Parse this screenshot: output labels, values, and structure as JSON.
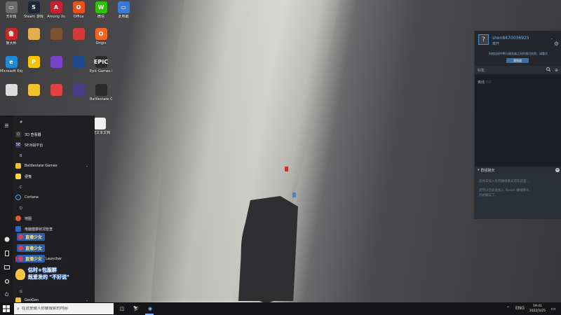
{
  "desktop": {
    "icons": [
      {
        "label": "无标题",
        "glyph": "▭",
        "color": "#6a6a6a"
      },
      {
        "label": "Steam 游戏",
        "glyph": "S",
        "color": "#1b2838"
      },
      {
        "label": "Among Us",
        "glyph": "A",
        "color": "#c8202c"
      },
      {
        "label": "Office",
        "glyph": "O",
        "color": "#e8501e"
      },
      {
        "label": "微信",
        "glyph": "W",
        "color": "#2dc100"
      },
      {
        "label": "此电脑",
        "glyph": "▭",
        "color": "#3b7ad0"
      },
      {
        "label": "鲁大师",
        "glyph": "鲁",
        "color": "#c62828"
      },
      {
        "label": "",
        "glyph": "",
        "color": "#e0b050"
      },
      {
        "label": "",
        "glyph": "",
        "color": "#7a5230"
      },
      {
        "label": "",
        "glyph": "",
        "color": "#d33a3a"
      },
      {
        "label": "Origin",
        "glyph": "O",
        "color": "#f26522"
      },
      {
        "label": "Microsoft Edge",
        "glyph": "e",
        "color": "#1f8ad8"
      },
      {
        "label": "",
        "glyph": "P",
        "color": "#f6c500"
      },
      {
        "label": "",
        "glyph": "",
        "color": "#7a42c8"
      },
      {
        "label": "",
        "glyph": "",
        "color": "#1a4a8a"
      },
      {
        "label": "Epic Games Launcher",
        "glyph": "EPIC",
        "color": "#2a2a2a"
      },
      {
        "label": "",
        "glyph": "",
        "color": "#dddddd"
      },
      {
        "label": "",
        "glyph": "",
        "color": "#f2c12e"
      },
      {
        "label": "",
        "glyph": "",
        "color": "#e04040"
      },
      {
        "label": "",
        "glyph": "",
        "color": "#4a3a8a"
      },
      {
        "label": "Battlestate Games",
        "glyph": "",
        "color": "#2a2a2a"
      },
      {
        "label": "新建文本文档",
        "glyph": "",
        "color": "#f0f0f0"
      }
    ]
  },
  "start_menu": {
    "rail": [
      "☰",
      "",
      "",
      "",
      "",
      "",
      "⏻"
    ],
    "sections": [
      {
        "letter": "#"
      },
      {
        "letter": "B"
      },
      {
        "letter": "C"
      },
      {
        "letter": "D"
      },
      {
        "letter": "G"
      }
    ],
    "apps": [
      {
        "label": "3D 查看器",
        "color": "#3a3a3a",
        "glyph": "⬡"
      },
      {
        "label": "5E对战平台",
        "color": "#333a5a",
        "glyph": "5E"
      },
      {
        "label": "Battlestate Games",
        "color": "#f2c12e",
        "glyph": "",
        "chevron": "⌄"
      },
      {
        "label": "便笺",
        "color": "#f2d84a",
        "glyph": ""
      },
      {
        "label": "Cortana",
        "color": "#1f1f22",
        "glyph": "○"
      },
      {
        "label": "地图",
        "color": "#e05a3a",
        "glyph": "●"
      },
      {
        "label": "电脑健康状况检查",
        "color": "#2a6ad0",
        "glyph": ""
      },
      {
        "label": "Launcher",
        "color": "#e02a5a",
        "glyph": ""
      },
      {
        "label": "GeoGen",
        "color": "#f2c12e",
        "glyph": "",
        "chevron": "⌄"
      }
    ]
  },
  "overlay": {
    "badges": [
      "直播少女",
      "直播少女",
      "直播少女"
    ],
    "caption_line1": "估时+包服群",
    "caption_line2": "既爱发的 \"不好说\""
  },
  "steam": {
    "avatar_glyph": "?",
    "username": "shen8470036925",
    "status": "离开",
    "notice": "网络连接中断与服务器之间的通讯失败，请重试",
    "accept_label": "我知道",
    "friends_label": "好友",
    "offline_label": "离线",
    "offline_count": "0/0",
    "chat_header": "群组聊天",
    "chat_line1": "您尚未加入任何群组聊天可在这里...",
    "chat_line2": "您可以在此处加入 Steam 群组聊天，",
    "chat_line3": "开始聊天了。"
  },
  "taskbar": {
    "search_placeholder": "在这里输入你要搜索的内容",
    "lang": "ENG",
    "time": "19:41",
    "date": "2022/3/25"
  },
  "colors": {
    "taskbar_bg": "#151517",
    "steam_accent": "#4a8fd8",
    "start_bg": "#1f1f22"
  }
}
